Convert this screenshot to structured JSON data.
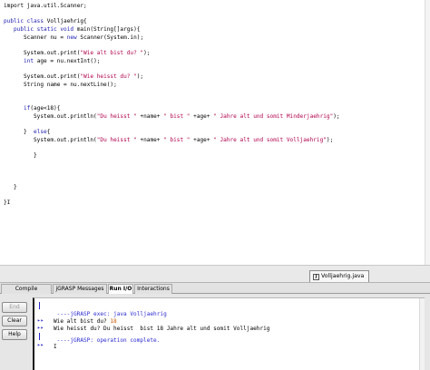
{
  "editor": {
    "lines": [
      [
        {
          "t": "import java.util.Scanner;",
          "c": ""
        }
      ],
      [
        {
          "t": "",
          "c": ""
        }
      ],
      [
        {
          "t": "public class ",
          "c": "kw"
        },
        {
          "t": "Volljaehrig{",
          "c": ""
        }
      ],
      [
        {
          "t": "   public static void ",
          "c": "kw"
        },
        {
          "t": "main(String[]args){",
          "c": ""
        }
      ],
      [
        {
          "t": "      Scanner nu = ",
          "c": ""
        },
        {
          "t": "new ",
          "c": "kw"
        },
        {
          "t": "Scanner(System.in);",
          "c": ""
        }
      ],
      [
        {
          "t": "",
          "c": ""
        }
      ],
      [
        {
          "t": "      System.out.print(",
          "c": ""
        },
        {
          "t": "\"Wie alt bist du? \"",
          "c": "str"
        },
        {
          "t": ");",
          "c": ""
        }
      ],
      [
        {
          "t": "      ",
          "c": ""
        },
        {
          "t": "int ",
          "c": "kw"
        },
        {
          "t": "age = nu.nextInt();",
          "c": ""
        }
      ],
      [
        {
          "t": "",
          "c": ""
        }
      ],
      [
        {
          "t": "      System.out.print(",
          "c": ""
        },
        {
          "t": "\"Wie heisst du? \"",
          "c": "str"
        },
        {
          "t": ");",
          "c": ""
        }
      ],
      [
        {
          "t": "      String name = nu.nextLine();",
          "c": ""
        }
      ],
      [
        {
          "t": "",
          "c": ""
        }
      ],
      [
        {
          "t": "",
          "c": ""
        }
      ],
      [
        {
          "t": "      ",
          "c": ""
        },
        {
          "t": "if",
          "c": "kw"
        },
        {
          "t": "(age<18){",
          "c": ""
        }
      ],
      [
        {
          "t": "         System.out.println(",
          "c": ""
        },
        {
          "t": "\"Du heisst \"",
          "c": "str"
        },
        {
          "t": " +name+ ",
          "c": ""
        },
        {
          "t": "\" bist \"",
          "c": "str"
        },
        {
          "t": " +age+ ",
          "c": ""
        },
        {
          "t": "\" Jahre alt und somit Minderjaehrig\"",
          "c": "str"
        },
        {
          "t": ");",
          "c": ""
        }
      ],
      [
        {
          "t": "",
          "c": ""
        }
      ],
      [
        {
          "t": "      }  ",
          "c": ""
        },
        {
          "t": "else",
          "c": "kw"
        },
        {
          "t": "{",
          "c": ""
        }
      ],
      [
        {
          "t": "         System.out.println(",
          "c": ""
        },
        {
          "t": "\"Du heisst \"",
          "c": "str"
        },
        {
          "t": " +name+ ",
          "c": ""
        },
        {
          "t": "\" bist \"",
          "c": "str"
        },
        {
          "t": " +age+ ",
          "c": ""
        },
        {
          "t": "\" Jahre alt und somit Volljaehrig\"",
          "c": "str"
        },
        {
          "t": ");",
          "c": ""
        }
      ],
      [
        {
          "t": "",
          "c": ""
        }
      ],
      [
        {
          "t": "         }",
          "c": ""
        }
      ],
      [
        {
          "t": "",
          "c": ""
        }
      ],
      [
        {
          "t": "",
          "c": ""
        }
      ],
      [
        {
          "t": "",
          "c": ""
        }
      ],
      [
        {
          "t": "   }",
          "c": ""
        }
      ],
      [
        {
          "t": "",
          "c": ""
        }
      ],
      [
        {
          "t": "}",
          "c": ""
        },
        {
          "t": "I",
          "c": "cursor"
        }
      ]
    ]
  },
  "file_tab": {
    "icon_letter": "J",
    "label": "Volljaehrig.java"
  },
  "message_tabs": [
    {
      "label": "Compile Messages",
      "active": false
    },
    {
      "label": "jGRASP Messages",
      "active": false
    },
    {
      "label": "Run I/O",
      "active": true
    },
    {
      "label": "Interactions",
      "active": false
    }
  ],
  "io_buttons": {
    "end": "End",
    "clear": "Clear",
    "help": "Help"
  },
  "console": {
    "gutter_arrow": "▸▸",
    "exec_line": " ----jGRASP exec: java Volljaehrig",
    "prompt_age": "Wie alt bist du? ",
    "input_age": "18",
    "output_line": "Wie heisst du? Du heisst  bist 18 Jahre alt und somit Volljaehrig",
    "complete_line": " ----jGRASP: operation complete.",
    "caret": "I"
  },
  "colors": {
    "keyword": "#1a1ab0",
    "string": "#b0004a",
    "grasp": "#2a2ad0",
    "user_input": "#c85a00"
  }
}
